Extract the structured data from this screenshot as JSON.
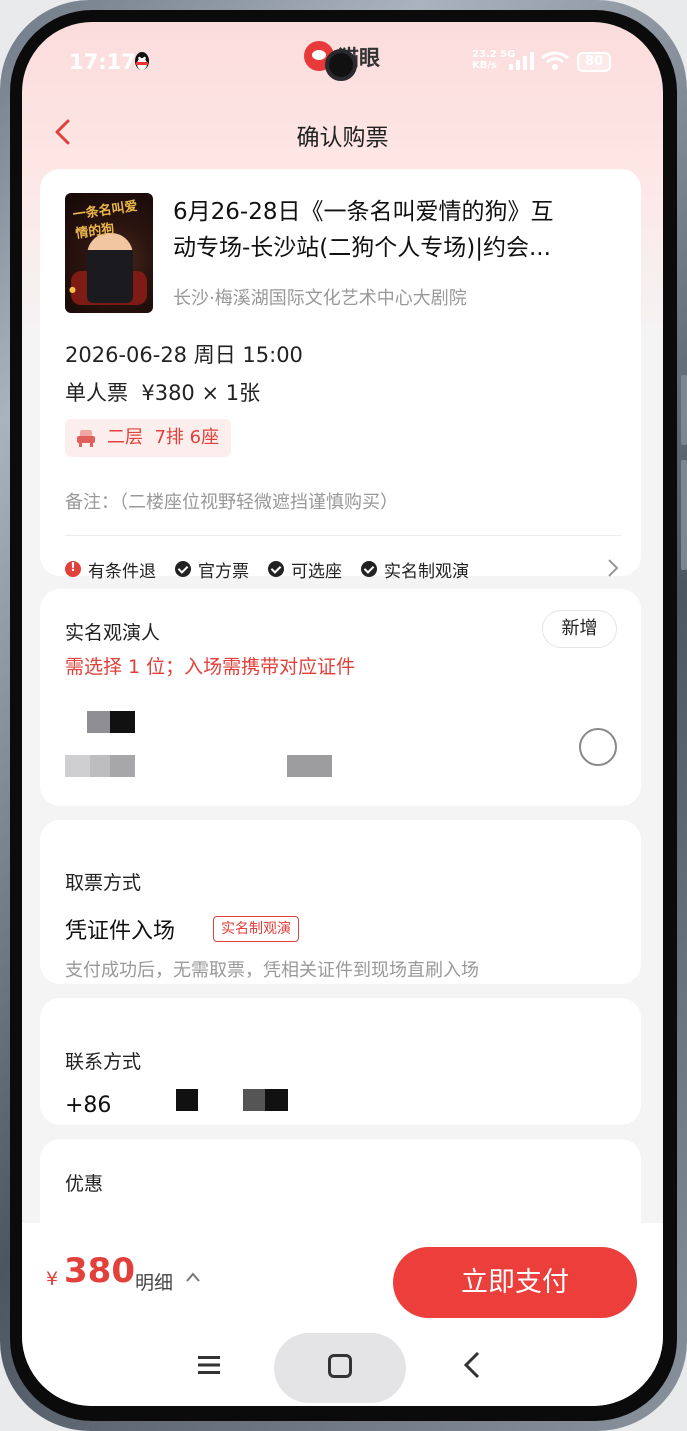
{
  "status_bar": {
    "time": "17:17",
    "app_name": "猫眼",
    "net_speed_value": "23.2",
    "net_speed_unit": "KB/s",
    "network": "5G",
    "battery": "80"
  },
  "header": {
    "title": "确认购票"
  },
  "show": {
    "title_line1": "6月26-28日《一条名叫爱情的狗》互",
    "title_line2": "动专场-长沙站(二狗个人专场)|约会...",
    "venue": "长沙·梅溪湖国际文化艺术中心大剧院",
    "datetime": "2026-06-28 周日 15:00",
    "ticket": "单人票  ¥380 × 1张",
    "seat": "二层  7排 6座",
    "note": "备注：（二楼座位视野轻微遮挡谨慎购买）",
    "poster_text": "一条名叫爱情的狗",
    "tags": [
      "有条件退",
      "官方票",
      "可选座",
      "实名制观演"
    ]
  },
  "viewer": {
    "title": "实名观演人",
    "add_label": "新增",
    "hint": "需选择 1 位；入场需携带对应证件"
  },
  "pickup": {
    "title": "取票方式",
    "type": "凭证件入场",
    "tag": "实名制观演",
    "desc": "支付成功后，无需取票，凭相关证件到现场直刷入场"
  },
  "contact": {
    "title": "联系方式",
    "phone_prefix": "+86"
  },
  "discount": {
    "title": "优惠"
  },
  "bottom": {
    "currency": "¥",
    "price": "380",
    "detail_label": "明细",
    "pay_label": "立即支付"
  },
  "colors": {
    "accent": "#e2403a",
    "pay_button": "#ec3f3b"
  },
  "icons": [
    "back-arrow-icon",
    "qq-icon",
    "signal-icon",
    "wifi-icon",
    "seat-icon",
    "warning-icon",
    "check-icon",
    "chevron-right-icon",
    "chevron-up-icon",
    "menu-icon",
    "home-icon",
    "nav-back-icon"
  ]
}
